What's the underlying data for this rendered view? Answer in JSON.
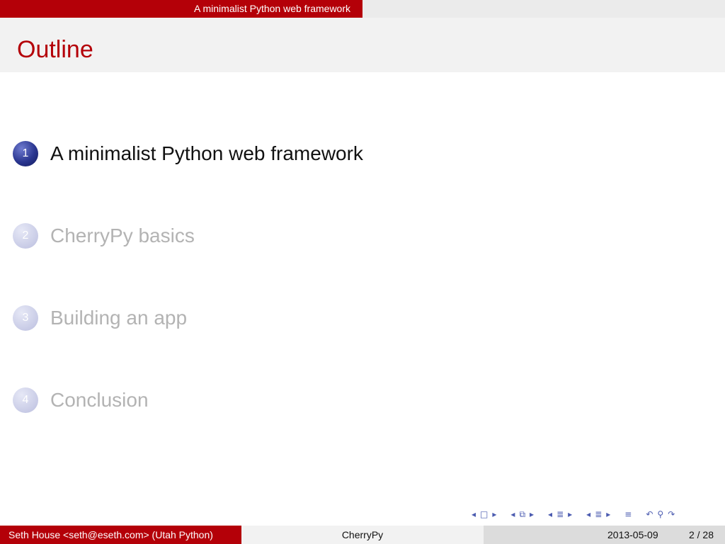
{
  "header": {
    "section_title": "A minimalist Python web framework"
  },
  "frame": {
    "title": "Outline"
  },
  "toc": [
    {
      "number": "1",
      "label": "A minimalist Python web framework",
      "state": "active"
    },
    {
      "number": "2",
      "label": "CherryPy basics",
      "state": "inactive"
    },
    {
      "number": "3",
      "label": "Building an app",
      "state": "inactive"
    },
    {
      "number": "4",
      "label": "Conclusion",
      "state": "inactive"
    }
  ],
  "nav_icons": [
    "arrow-left-icon",
    "frame-icon",
    "arrow-right-icon",
    "arrow-left-icon",
    "subsection-icon",
    "arrow-right-icon",
    "arrow-left-icon",
    "section-icon",
    "arrow-right-icon",
    "arrow-left-icon",
    "presentation-icon",
    "arrow-right-icon",
    "align-icon",
    "undo-icon",
    "search-icon",
    "redo-icon"
  ],
  "footer": {
    "author": "Seth House <seth@eseth.com>  (Utah Python)",
    "short_title": "CherryPy",
    "date": "2013-05-09",
    "page": "2 / 28"
  },
  "colors": {
    "accent": "#b40008",
    "bullet_active": "#2a3690",
    "bullet_inactive": "#c8cbe6",
    "inactive_text": "#b3b3b3"
  }
}
